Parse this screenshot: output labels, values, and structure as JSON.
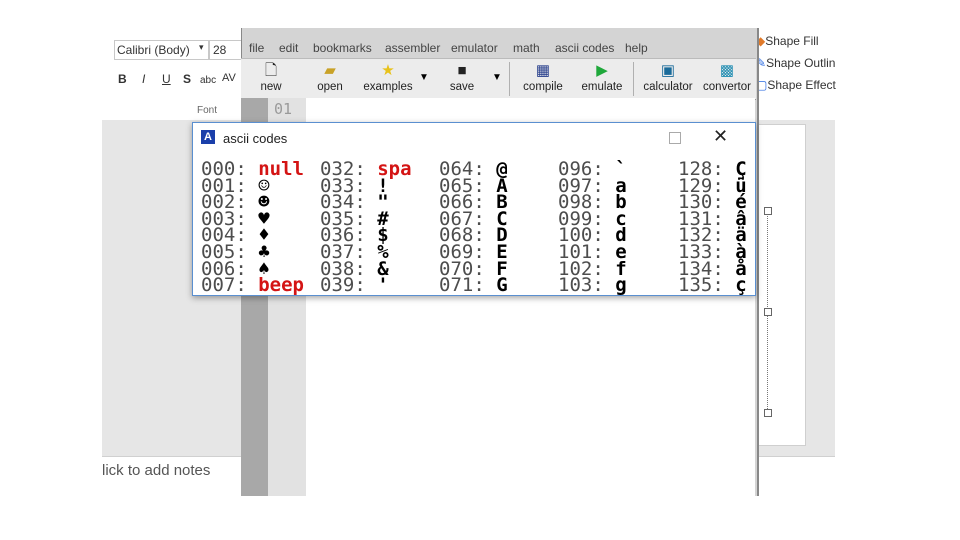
{
  "ppt": {
    "font_name": "Calibri (Body)",
    "font_size": "28",
    "format_buttons": [
      "B",
      "I",
      "U",
      "S",
      "abc",
      "AV"
    ],
    "font_group_label": "Font",
    "shape_fill": "Shape Fill",
    "shape_outline": "Shape Outlin",
    "shape_effects": "Shape Effect",
    "notes_placeholder": "lick to add notes"
  },
  "emu": {
    "menu": [
      "file",
      "edit",
      "bookmarks",
      "assembler",
      "emulator",
      "math",
      "ascii codes",
      "help"
    ],
    "toolbar": [
      {
        "label": "new",
        "icon": "new-file-icon"
      },
      {
        "label": "open",
        "icon": "open-folder-icon"
      },
      {
        "label": "examples",
        "icon": "star-icon"
      },
      {
        "label": "save",
        "icon": "floppy-disk-icon"
      },
      {
        "label": "compile",
        "icon": "chip-icon"
      },
      {
        "label": "emulate",
        "icon": "play-icon"
      },
      {
        "label": "calculator",
        "icon": "calculator-icon"
      },
      {
        "label": "convertor",
        "icon": "convertor-icon"
      }
    ],
    "line_number": "01"
  },
  "ascii": {
    "title": "ascii codes",
    "columns": [
      [
        [
          "000:",
          "null",
          true
        ],
        [
          "001:",
          "☺",
          false
        ],
        [
          "002:",
          "☻",
          false
        ],
        [
          "003:",
          "♥",
          false
        ],
        [
          "004:",
          "♦",
          false
        ],
        [
          "005:",
          "♣",
          false
        ],
        [
          "006:",
          "♠",
          false
        ],
        [
          "007:",
          "beep",
          true
        ]
      ],
      [
        [
          "032:",
          "spa",
          true
        ],
        [
          "033:",
          "!",
          false
        ],
        [
          "034:",
          "\"",
          false
        ],
        [
          "035:",
          "#",
          false
        ],
        [
          "036:",
          "$",
          false
        ],
        [
          "037:",
          "%",
          false
        ],
        [
          "038:",
          "&",
          false
        ],
        [
          "039:",
          "'",
          false
        ]
      ],
      [
        [
          "064:",
          "@",
          false
        ],
        [
          "065:",
          "A",
          false
        ],
        [
          "066:",
          "B",
          false
        ],
        [
          "067:",
          "C",
          false
        ],
        [
          "068:",
          "D",
          false
        ],
        [
          "069:",
          "E",
          false
        ],
        [
          "070:",
          "F",
          false
        ],
        [
          "071:",
          "G",
          false
        ]
      ],
      [
        [
          "096:",
          "`",
          false
        ],
        [
          "097:",
          "a",
          false
        ],
        [
          "098:",
          "b",
          false
        ],
        [
          "099:",
          "c",
          false
        ],
        [
          "100:",
          "d",
          false
        ],
        [
          "101:",
          "e",
          false
        ],
        [
          "102:",
          "f",
          false
        ],
        [
          "103:",
          "g",
          false
        ]
      ],
      [
        [
          "128:",
          "Ç",
          false
        ],
        [
          "129:",
          "ü",
          false
        ],
        [
          "130:",
          "é",
          false
        ],
        [
          "131:",
          "â",
          false
        ],
        [
          "132:",
          "ä",
          false
        ],
        [
          "133:",
          "à",
          false
        ],
        [
          "134:",
          "å",
          false
        ],
        [
          "135:",
          "ç",
          false
        ]
      ]
    ]
  }
}
